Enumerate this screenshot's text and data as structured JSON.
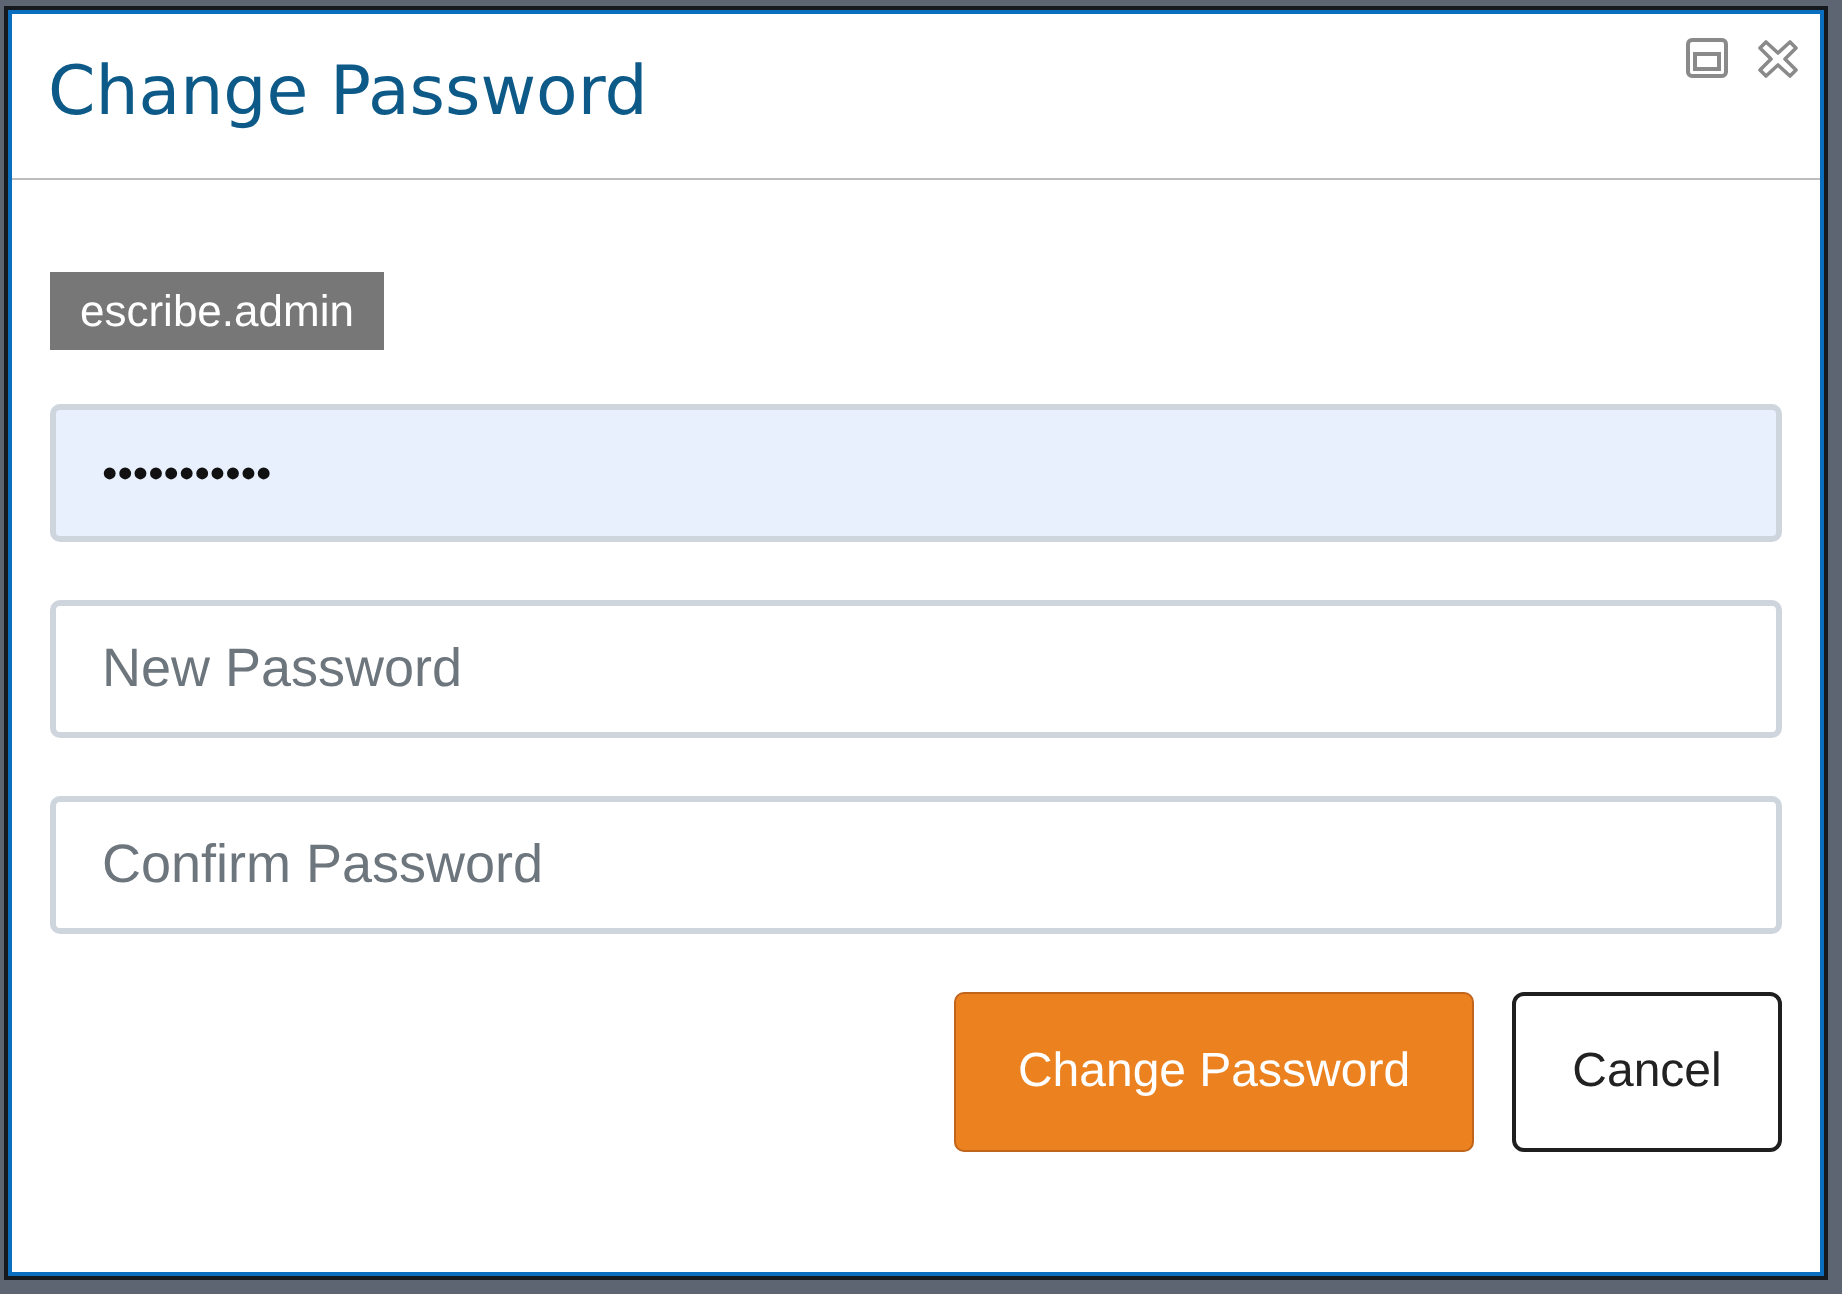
{
  "dialog": {
    "title": "Change Password"
  },
  "user_badge": "escribe.admin",
  "fields": [
    {
      "value": "•••••••••••",
      "autofilled": true
    },
    {
      "placeholder": "New Password",
      "autofilled": false
    },
    {
      "placeholder": "Confirm Password",
      "autofilled": false
    }
  ],
  "buttons": [
    {
      "label": "Change Password",
      "kind": "primary"
    },
    {
      "label": "Cancel",
      "kind": "secondary"
    }
  ]
}
